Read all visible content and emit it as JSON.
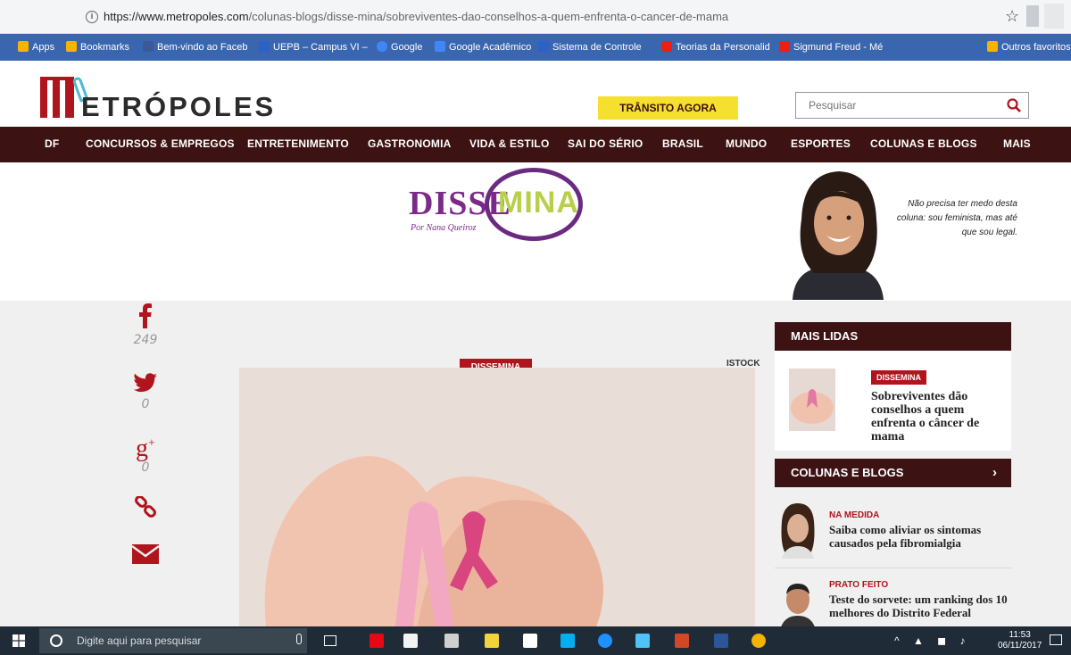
{
  "browser": {
    "url_host": "https://www.metropoles.com",
    "url_path": "/colunas-blogs/disse-mina/sobreviventes-dao-conselhos-a-quem-enfrenta-o-cancer-de-mama",
    "bookmarks": [
      {
        "label": "Apps",
        "color": "#f4b400"
      },
      {
        "label": "Bookmarks",
        "color": "#f4b400"
      },
      {
        "label": "Bem-vindo ao Faceb",
        "color": "#3b5998"
      },
      {
        "label": "UEPB – Campus VI –",
        "color": "#2c62c6"
      },
      {
        "label": "Google",
        "color": "#4285f4"
      },
      {
        "label": "Google Acadêmico",
        "color": "#4285f4"
      },
      {
        "label": "Sistema de Controle",
        "color": "#2c62c6"
      },
      {
        "label": "Teorias da Personalid",
        "color": "#e62117"
      },
      {
        "label": "Sigmund Freud - Mé",
        "color": "#e62117"
      },
      {
        "label": "Outros favoritos",
        "color": "#f4b400"
      }
    ]
  },
  "header": {
    "logo_text": "ETRÓPOLES",
    "transito_label": "TRÂNSITO AGORA",
    "search_placeholder": "Pesquisar"
  },
  "nav": [
    "DF",
    "CONCURSOS & EMPREGOS",
    "ENTRETENIMENTO",
    "GASTRONOMIA",
    "VIDA & ESTILO",
    "SAI DO SÉRIO",
    "BRASIL",
    "MUNDO",
    "ESPORTES",
    "COLUNAS E BLOGS",
    "MAIS"
  ],
  "column": {
    "name_part1": "DISSE",
    "name_part2": "MINA",
    "byline": "Por Nana Queiroz",
    "quote": "Não precisa ter medo desta coluna: sou feminista, mas até que sou legal."
  },
  "share": {
    "facebook_count": "249",
    "twitter_count": "0",
    "gplus_count": "0"
  },
  "article": {
    "tag": "DISSEMINA",
    "photo_credit": "ISTOCK"
  },
  "sidebar": {
    "mais_lidas_title": "MAIS LIDAS",
    "mais_lidas_tag": "DISSEMINA",
    "mais_lidas_headline": "Sobreviventes dão conselhos a quem enfrenta o câncer de mama",
    "colunas_title": "COLUNAS E BLOGS",
    "colunas_chevron": "›",
    "items": [
      {
        "category": "NA MEDIDA",
        "headline": "Saiba como aliviar os sintomas causados pela fibromialgia"
      },
      {
        "category": "PRATO FEITO",
        "headline": "Teste do sorvete: um ranking dos 10 melhores do Distrito Federal"
      }
    ]
  },
  "taskbar": {
    "search_placeholder": "Digite aqui para pesquisar",
    "time": "11:53",
    "date": "06/11/2017"
  },
  "colors": {
    "brand_red": "#b0141c",
    "nav_bg": "#3d1212",
    "highlight_yellow": "#f5e030",
    "column_purple": "#7b2a8a",
    "column_green": "#b8cf4a"
  }
}
